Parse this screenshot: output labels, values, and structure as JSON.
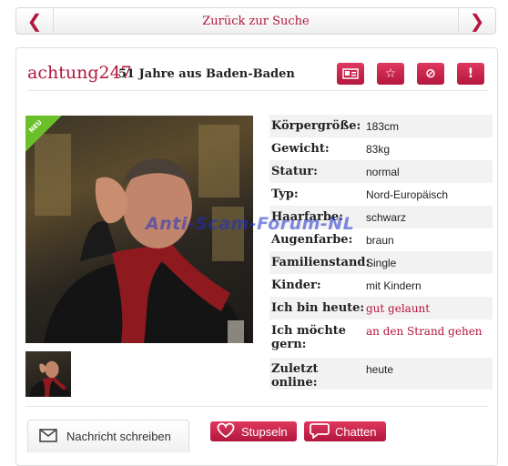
{
  "nav": {
    "back_label": "Zurück zur Suche",
    "prev_icon": "chevron-left-icon",
    "next_icon": "chevron-right-icon"
  },
  "profile": {
    "username": "achtung247",
    "subtitle": "51 Jahre aus Baden-Baden",
    "badge": "NEU",
    "actions": [
      "id-card-icon",
      "star-icon",
      "block-icon",
      "report-icon"
    ]
  },
  "attributes": [
    {
      "label": "Körpergröße:",
      "value": "183cm"
    },
    {
      "label": "Gewicht:",
      "value": "83kg"
    },
    {
      "label": "Statur:",
      "value": "normal"
    },
    {
      "label": "Typ:",
      "value": "Nord-Europäisch"
    },
    {
      "label": "Haarfarbe:",
      "value": "schwarz"
    },
    {
      "label": "Augenfarbe:",
      "value": "braun"
    },
    {
      "label": "Familienstand:",
      "value": "Single"
    },
    {
      "label": "Kinder:",
      "value": "mit Kindern"
    },
    {
      "label": "Ich bin heute:",
      "value": "gut gelaunt"
    },
    {
      "label": "Ich möchte gern:",
      "value": "an den Strand gehen"
    },
    {
      "label": "Zuletzt online:",
      "value": "heute"
    }
  ],
  "watermark": "Anti-Scam-Forum-NL",
  "bottom": {
    "message_tab": "Nachricht schreiben",
    "stupsen": "Stupseln",
    "chatten": "Chatten"
  },
  "colors": {
    "accent": "#b3163e",
    "new_badge": "#6bbf2a"
  }
}
